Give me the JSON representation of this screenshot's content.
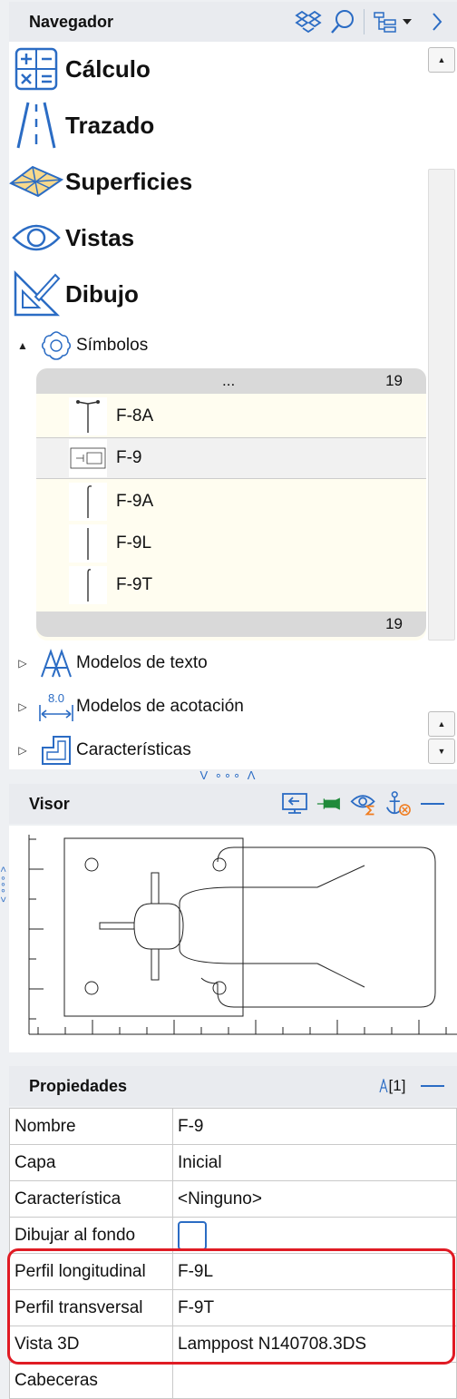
{
  "navigator": {
    "title": "Navegador",
    "categories": [
      {
        "label": "Cálculo",
        "icon": "calculator-icon"
      },
      {
        "label": "Trazado",
        "icon": "road-icon"
      },
      {
        "label": "Superficies",
        "icon": "surface-icon"
      },
      {
        "label": "Vistas",
        "icon": "eye-icon"
      },
      {
        "label": "Dibujo",
        "icon": "drawing-icon"
      }
    ],
    "symbols_node": {
      "label": "Símbolos",
      "expanded": true,
      "toggle": "▲"
    },
    "symbols_list": {
      "header_dots": "...",
      "count": "19",
      "footer_count": "19",
      "items": [
        {
          "label": "F-8A",
          "selected": false
        },
        {
          "label": "F-9",
          "selected": true
        },
        {
          "label": "F-9A",
          "selected": false
        },
        {
          "label": "F-9L",
          "selected": false
        },
        {
          "label": "F-9T",
          "selected": false
        }
      ]
    },
    "tree_nodes": [
      {
        "label": "Modelos de texto",
        "toggle": "▷"
      },
      {
        "label": "Modelos de acotación",
        "toggle": "▷",
        "icon_text": "8.0"
      },
      {
        "label": "Características",
        "toggle": "▷"
      }
    ],
    "grip": "V ∘∘∘ Λ"
  },
  "visor": {
    "title": "Visor",
    "side_grip": "< ∘∘∘ >"
  },
  "properties": {
    "title": "Propiedades",
    "count": "[1]",
    "rows": [
      {
        "key": "Nombre",
        "value": "F-9"
      },
      {
        "key": "Capa",
        "value": "Inicial"
      },
      {
        "key": "Característica",
        "value": "<Ninguno>"
      },
      {
        "key": "Dibujar al fondo",
        "value": ""
      },
      {
        "key": "Perfil longitudinal",
        "value": "F-9L"
      },
      {
        "key": "Perfil transversal",
        "value": "F-9T"
      },
      {
        "key": "Vista 3D",
        "value": "Lamppost N140708.3DS"
      },
      {
        "key": "Cabeceras",
        "value": ""
      }
    ]
  },
  "colors": {
    "accent": "#2b6cc4",
    "highlight": "#e01b24",
    "orange": "#f07b1c",
    "green": "#1f8a3a"
  }
}
